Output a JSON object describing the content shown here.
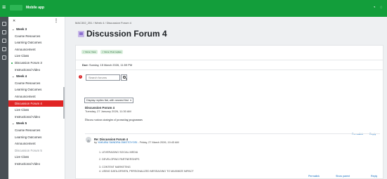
{
  "app": {
    "title": "Mobile app"
  },
  "course_index": {
    "items": [
      {
        "label": "Week 3",
        "kind": "section"
      },
      {
        "label": "Course Resources",
        "kind": "item"
      },
      {
        "label": "Learning Outcomes",
        "kind": "item"
      },
      {
        "label": "Announcement",
        "kind": "item"
      },
      {
        "label": "Live Class",
        "kind": "item"
      },
      {
        "label": "Discussion Forum 3",
        "kind": "done"
      },
      {
        "label": "Instructional Video",
        "kind": "item"
      },
      {
        "label": "Week 4",
        "kind": "section"
      },
      {
        "label": "Course Resources",
        "kind": "item"
      },
      {
        "label": "Learning Outcomes",
        "kind": "item"
      },
      {
        "label": "Announcement",
        "kind": "item"
      },
      {
        "label": "Discussion Forum 4",
        "kind": "active"
      },
      {
        "label": "Live Class",
        "kind": "item"
      },
      {
        "label": "Instructional Video",
        "kind": "item"
      },
      {
        "label": "Week 5",
        "kind": "section"
      },
      {
        "label": "Course Resources",
        "kind": "item"
      },
      {
        "label": "Learning Outcomes",
        "kind": "item"
      },
      {
        "label": "Announcement",
        "kind": "item"
      },
      {
        "label": "Discussion Forum 5",
        "kind": "muted"
      },
      {
        "label": "Live Class",
        "kind": "item"
      },
      {
        "label": "Instructional Video",
        "kind": "item"
      }
    ]
  },
  "breadcrumb": "MAC302_251 / Week 4 / Discussion Forum 4",
  "page": {
    "title": "Discussion Forum 4",
    "badges": [
      "✓ Done: View",
      "✓ Done: Post replies"
    ],
    "due_label": "Due:",
    "due_value": "Sunday, 15 March 2026, 11:59 PM"
  },
  "search": {
    "placeholder": "Search forums"
  },
  "display_mode": {
    "selected": "Display replies flat, with newest first"
  },
  "post": {
    "title": "Discussion Forum 4",
    "date": "Tuesday, 27 January 2026, 11:30 AM",
    "body": "Discuss various strategies of promoting programmes",
    "permalink": "Permalink",
    "reply": "Reply"
  },
  "reply_post": {
    "title": "Re: Discussion Forum 4",
    "by_prefix": "by",
    "author": "YAKUBU SANDRA OMOTOYOSI",
    "date_suffix": "- Friday, 27 March 2026, 10:43 AM",
    "lines": [
      "1. LEVERAGING SOCIAL MEDIA",
      "2. DEVELOPING PARTNERSHIPS",
      "3. CONTENT MARKETING",
      "4. USING DATA-DRIVEN, PERSONALIZED MESSAGING TO MAXIMIZE IMPACT"
    ],
    "permalink": "Permalink",
    "show_parent": "Show parent",
    "reply": "Reply"
  },
  "colors": {
    "brand": "#139e3b",
    "active": "#e02424",
    "link": "#0f6cbf"
  },
  "icons": [
    "hamburger-icon",
    "bell-icon",
    "chat-icon",
    "search-icon",
    "magnifier-icon",
    "chevron-down-icon",
    "forum-icon",
    "avatar"
  ]
}
